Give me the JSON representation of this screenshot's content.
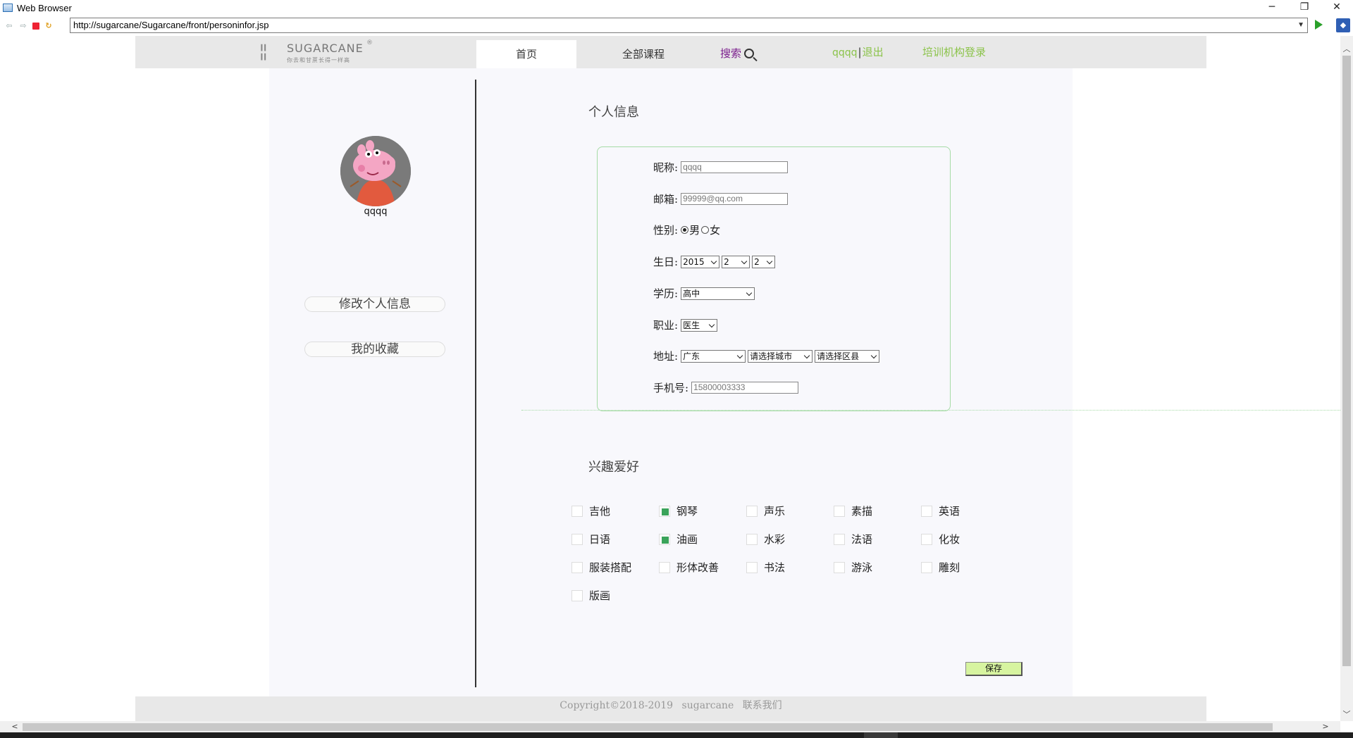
{
  "window": {
    "title": "Web Browser",
    "minimize_glyph": "─",
    "restore_glyph": "❐",
    "close_glyph": "✕"
  },
  "browser": {
    "url": "http://sugarcane/Sugarcane/front/personinfor.jsp"
  },
  "header": {
    "logo": {
      "brand": "SUGARCANE",
      "registered": "®",
      "tagline": "你去和甘蔗长得一样高"
    },
    "nav": {
      "home": "首页",
      "all_courses": "全部课程",
      "search": "搜索",
      "username": "qqqq",
      "separator": "|",
      "logout": "退出",
      "org_login": "培训机构登录"
    }
  },
  "sidebar": {
    "username": "qqqq",
    "edit_profile": "修改个人信息",
    "favorites": "我的收藏"
  },
  "profile": {
    "section_title": "个人信息",
    "nickname": {
      "label": "昵称:",
      "value": "qqqq"
    },
    "email": {
      "label": "邮箱:",
      "value": "99999@qq.com"
    },
    "gender": {
      "label": "性别:",
      "male": "男",
      "female": "女",
      "selected": "男"
    },
    "birthday": {
      "label": "生日:",
      "year": "2015",
      "month": "2",
      "day": "2"
    },
    "education": {
      "label": "学历:",
      "value": "高中"
    },
    "occupation": {
      "label": "职业:",
      "value": "医生"
    },
    "address": {
      "label": "地址:",
      "province": "广东",
      "city": "请选择城市",
      "district": "请选择区县"
    },
    "phone": {
      "label": "手机号:",
      "value": "15800003333"
    }
  },
  "hobbies": {
    "section_title": "兴趣爱好",
    "items": [
      {
        "label": "吉他",
        "checked": false
      },
      {
        "label": "钢琴",
        "checked": true
      },
      {
        "label": "声乐",
        "checked": false
      },
      {
        "label": "素描",
        "checked": false
      },
      {
        "label": "英语",
        "checked": false
      },
      {
        "label": "日语",
        "checked": false
      },
      {
        "label": "油画",
        "checked": true
      },
      {
        "label": "水彩",
        "checked": false
      },
      {
        "label": "法语",
        "checked": false
      },
      {
        "label": "化妆",
        "checked": false
      },
      {
        "label": "服装搭配",
        "checked": false
      },
      {
        "label": "形体改善",
        "checked": false
      },
      {
        "label": "书法",
        "checked": false
      },
      {
        "label": "游泳",
        "checked": false
      },
      {
        "label": "雕刻",
        "checked": false
      },
      {
        "label": "版画",
        "checked": false
      }
    ]
  },
  "save_label": "保存",
  "footer": {
    "copyright": "Copyright©2018-2019",
    "brand": "sugarcane",
    "contact": "联系我们"
  },
  "colors": {
    "accent_green": "#8bc34a",
    "search_purple": "#7a1c8c",
    "checkbox_green": "#3aa35a",
    "box_border": "#a6dba6",
    "save_bg": "#d7f4a0"
  }
}
